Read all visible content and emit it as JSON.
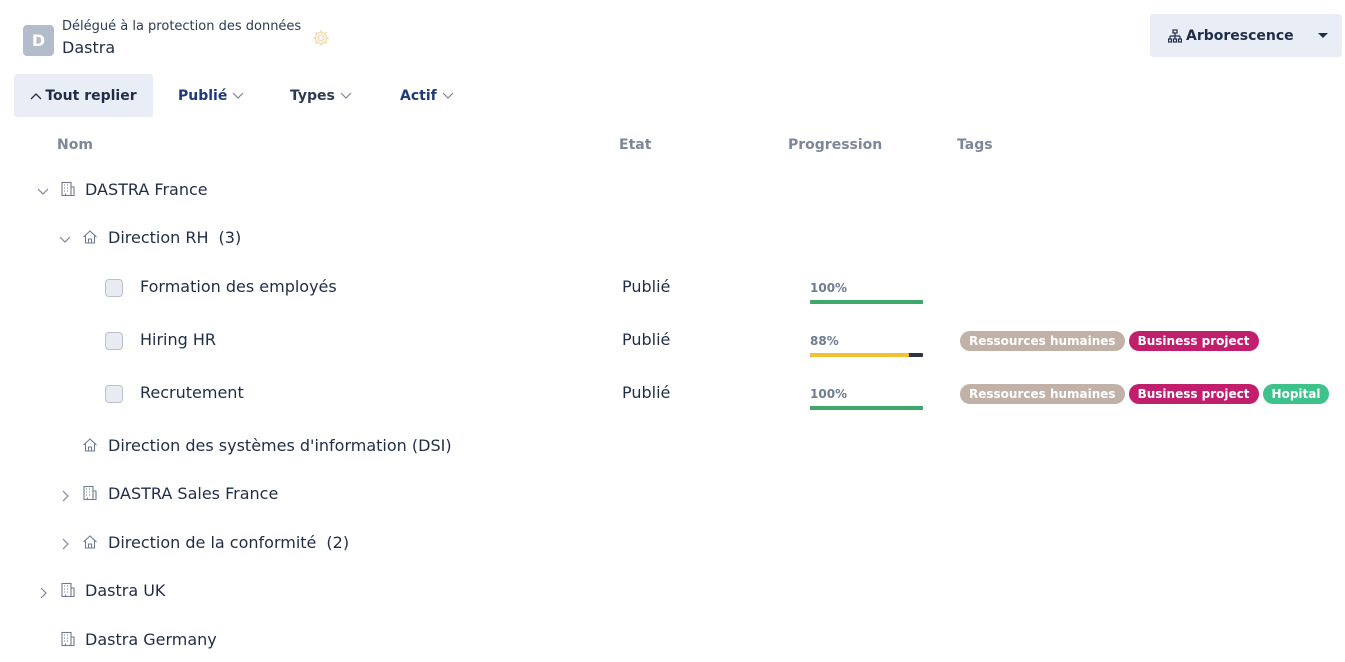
{
  "header": {
    "avatar_letter": "D",
    "role": "Délégué à la protection des données",
    "org": "Dastra",
    "view_button_label": "Arborescence"
  },
  "toolbar": {
    "collapse_label": "Tout replier",
    "filters": [
      {
        "label": "Publié",
        "color": "#1f3a78"
      },
      {
        "label": "Types",
        "color": "#2b3a55"
      },
      {
        "label": "Actif",
        "color": "#1f3a78"
      }
    ]
  },
  "columns": {
    "name": "Nom",
    "state": "Etat",
    "progress": "Progression",
    "tags": "Tags"
  },
  "tree": {
    "dastra_france": {
      "label": "DASTRA France",
      "icon": "building-icon",
      "expanded": true
    },
    "direction_rh": {
      "label": "Direction RH",
      "count": "(3)",
      "icon": "home-icon",
      "expanded": true
    },
    "treatments": [
      {
        "name": "Formation des employés",
        "state": "Publié",
        "progress_text": "100%",
        "progress": 1.0,
        "bar_color": "#3fa96b",
        "tags": []
      },
      {
        "name": "Hiring HR",
        "state": "Publié",
        "progress_text": "88%",
        "progress": 0.88,
        "bar_color": "#f2c12e",
        "tags": [
          {
            "label": "Ressources humaines",
            "color": "#c1b1a6"
          },
          {
            "label": "Business project",
            "color": "#c21e6e"
          }
        ]
      },
      {
        "name": "Recrutement",
        "state": "Publié",
        "progress_text": "100%",
        "progress": 1.0,
        "bar_color": "#3fa96b",
        "tags": [
          {
            "label": "Ressources humaines",
            "color": "#c1b1a6"
          },
          {
            "label": "Business project",
            "color": "#c21e6e"
          },
          {
            "label": "Hopital",
            "color": "#3cc28a"
          }
        ]
      }
    ],
    "dsi": {
      "label": "Direction des systèmes d'information (DSI)",
      "icon": "home-icon"
    },
    "sales_france": {
      "label": "DASTRA Sales France",
      "icon": "building-icon",
      "expanded": false
    },
    "conformite": {
      "label": "Direction de la conformité",
      "count": "(2)",
      "icon": "home-icon",
      "expanded": false
    },
    "dastra_uk": {
      "label": "Dastra UK",
      "icon": "building-icon",
      "expanded": false
    },
    "dastra_germany": {
      "label": "Dastra Germany",
      "icon": "building-icon"
    }
  }
}
